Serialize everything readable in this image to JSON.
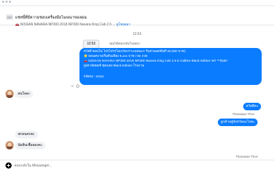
{
  "banner": {
    "title": "แชทนี้ที่มีความชอบเครื่องมือโฆษณาของคุณ",
    "car_emoji": "🚗",
    "subtitle": "NISSAN NAVARA NP300 2018 NP300 Navara King Cab 2.5 ...",
    "link": "ดูโฆษณา"
  },
  "thread": {
    "time_label": "12:53",
    "page_reply_label": "คุณได้ตอบกลับโฆษณา",
    "reply_chip": "12:53",
    "blue_message": {
      "line1": "สวัสดี ตอบไม่ ไปรไปรรไมเปรถเราะเพลนะก รับส่วนลดทันที 30,000 บาท)",
      "line2": "⭐ ผ่อนสบายเริ่มต้นเพียง 6,xxx บาท / 84 งวด",
      "line3": "🚗 NISSAN NAVARA NP300 2018 NP300 Navara King Cab 2.5 E Calibre Black Edition MT **รุ่นยก",
      "line4": "สูงตาลัยยอช์ ชุดแต่ง Black Edition โรงงาน",
      "line5": "รหัสรถ : E034"
    },
    "msg1": "สนใจคะ",
    "msg2_outgoing": "สวัสดีคะ",
    "sender_name": "Thanawan Thon",
    "msg3_outgoing": "ลูกค้าอยู่จังหวัดอะไรคะ",
    "msg4": "สกลนครคะ",
    "msg5": "นัดสินเชื่อลองคะ",
    "sender_name_bottom": "Thanawan Thon"
  },
  "composer": {
    "placeholder": "ตอบกลับใน Messenger..."
  }
}
